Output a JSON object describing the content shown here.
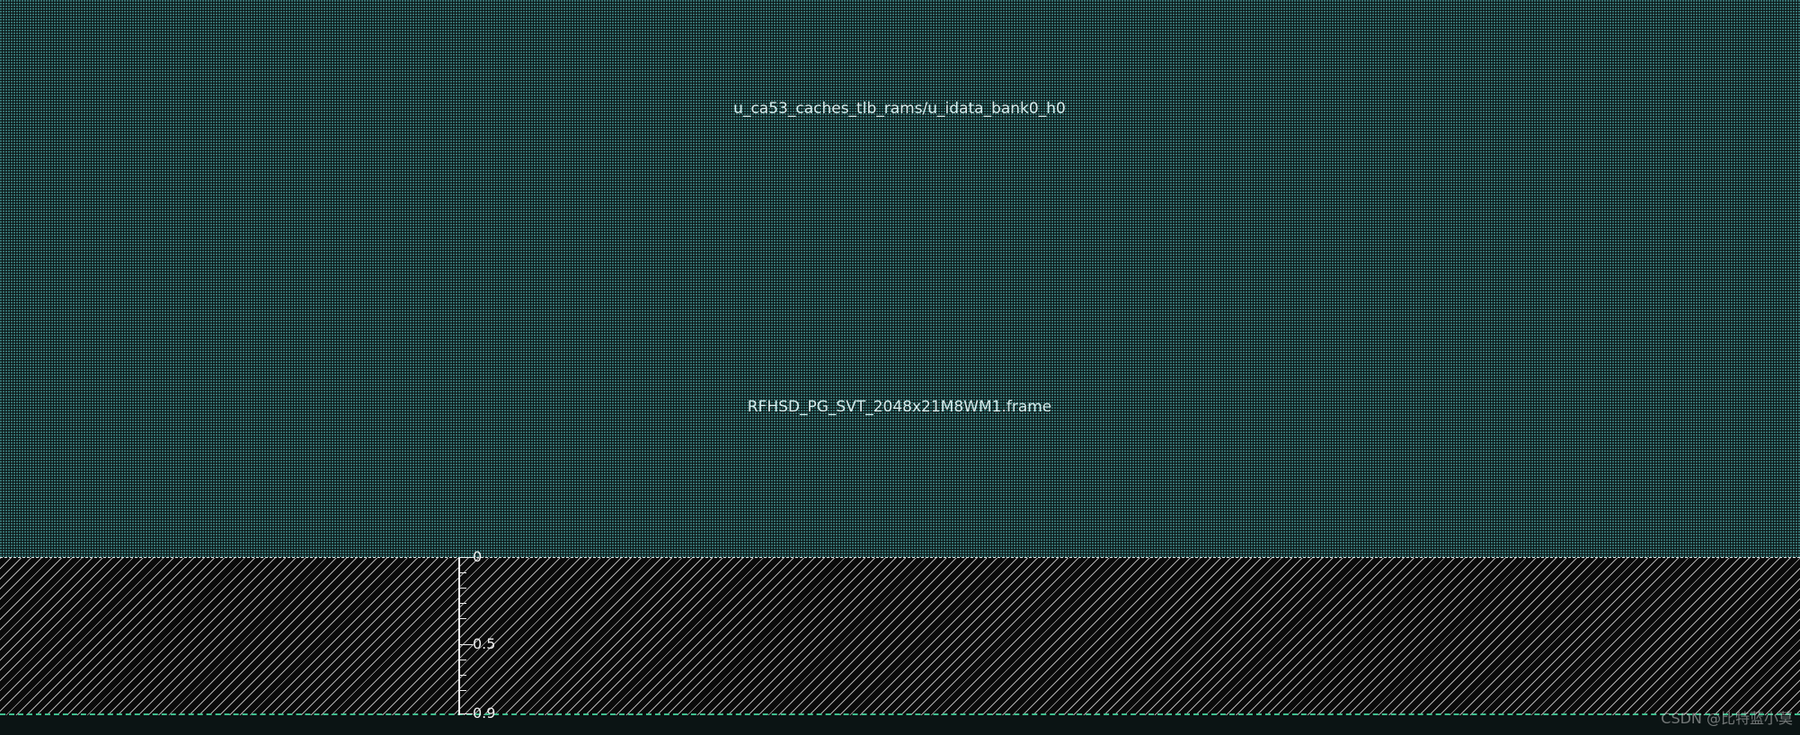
{
  "layout": {
    "instance_name": "u_ca53_caches_tlb_rams/u_idata_bank0_h0",
    "frame_name": "RFHSD_PG_SVT_2048x21M8WM1.frame"
  },
  "ruler": {
    "labels": [
      "0",
      "0.5",
      "0.9"
    ]
  },
  "colors": {
    "background": "#0b1414",
    "macro_fill": "#469696",
    "hatch": "#e6e6e6",
    "boundary": "#3fbf8f",
    "text": "#d8ecec"
  },
  "watermark": "CSDN @比特蓝小莫"
}
